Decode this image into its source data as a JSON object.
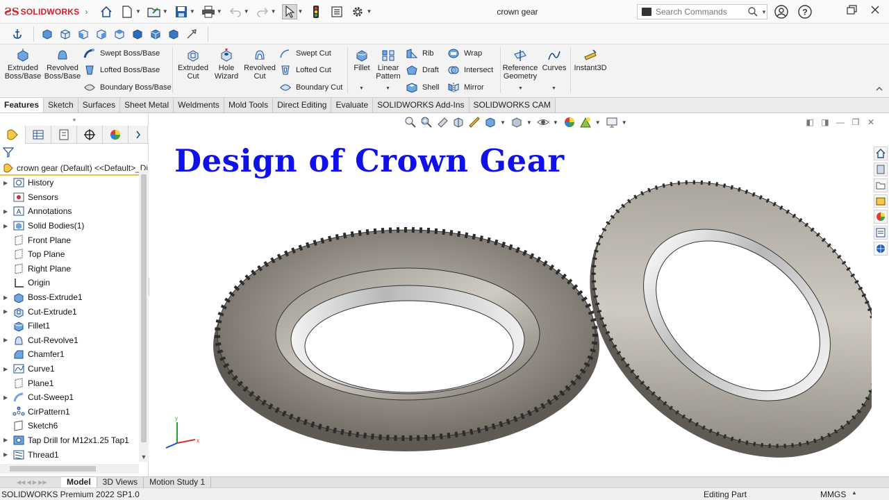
{
  "app": {
    "brand": "SOLIDWORKS",
    "doc_title": "crown gear"
  },
  "search": {
    "placeholder": "Search Commands"
  },
  "ribbon": {
    "extruded_boss": "Extruded Boss/Base",
    "revolved_boss": "Revolved Boss/Base",
    "swept_boss": "Swept Boss/Base",
    "lofted_boss": "Lofted Boss/Base",
    "boundary_boss": "Boundary Boss/Base",
    "extruded_cut": "Extruded Cut",
    "hole_wizard": "Hole Wizard",
    "revolved_cut": "Revolved Cut",
    "swept_cut": "Swept Cut",
    "lofted_cut": "Lofted Cut",
    "boundary_cut": "Boundary Cut",
    "fillet": "Fillet",
    "linear_pattern": "Linear Pattern",
    "rib": "Rib",
    "draft": "Draft",
    "shell": "Shell",
    "wrap": "Wrap",
    "intersect": "Intersect",
    "mirror": "Mirror",
    "reference_geometry": "Reference Geometry",
    "curves": "Curves",
    "instant3d": "Instant3D"
  },
  "tabs": [
    "Features",
    "Sketch",
    "Surfaces",
    "Sheet Metal",
    "Weldments",
    "Mold Tools",
    "Direct Editing",
    "Evaluate",
    "SOLIDWORKS Add-Ins",
    "SOLIDWORKS CAM"
  ],
  "tree": {
    "root": "crown gear (Default) <<Default>_Di",
    "items": [
      {
        "label": "History",
        "expandable": true,
        "icon": "history-icon"
      },
      {
        "label": "Sensors",
        "expandable": false,
        "icon": "sensor-icon"
      },
      {
        "label": "Annotations",
        "expandable": true,
        "icon": "annotation-icon"
      },
      {
        "label": "Solid Bodies(1)",
        "expandable": true,
        "icon": "solid-bodies-icon"
      },
      {
        "label": "Front Plane",
        "expandable": false,
        "icon": "plane-icon"
      },
      {
        "label": "Top Plane",
        "expandable": false,
        "icon": "plane-icon"
      },
      {
        "label": "Right Plane",
        "expandable": false,
        "icon": "plane-icon"
      },
      {
        "label": "Origin",
        "expandable": false,
        "icon": "origin-icon"
      },
      {
        "label": "Boss-Extrude1",
        "expandable": true,
        "icon": "extrude-icon"
      },
      {
        "label": "Cut-Extrude1",
        "expandable": true,
        "icon": "cut-extrude-icon"
      },
      {
        "label": "Fillet1",
        "expandable": false,
        "icon": "fillet-icon"
      },
      {
        "label": "Cut-Revolve1",
        "expandable": true,
        "icon": "cut-revolve-icon"
      },
      {
        "label": "Chamfer1",
        "expandable": false,
        "icon": "chamfer-icon"
      },
      {
        "label": "Curve1",
        "expandable": true,
        "icon": "curve-icon"
      },
      {
        "label": "Plane1",
        "expandable": false,
        "icon": "plane-icon"
      },
      {
        "label": "Cut-Sweep1",
        "expandable": true,
        "icon": "cut-sweep-icon"
      },
      {
        "label": "CirPattern1",
        "expandable": false,
        "icon": "circular-pattern-icon"
      },
      {
        "label": "Sketch6",
        "expandable": false,
        "icon": "sketch-icon"
      },
      {
        "label": "Tap Drill for M12x1.25 Tap1",
        "expandable": true,
        "icon": "hole-icon"
      },
      {
        "label": "Thread1",
        "expandable": true,
        "icon": "thread-icon"
      }
    ]
  },
  "viewport": {
    "heading": "Design of Crown Gear",
    "accent_color": "#1010e8"
  },
  "bottom_tabs": [
    "Model",
    "3D Views",
    "Motion Study 1"
  ],
  "status": {
    "product": "SOLIDWORKS Premium 2022 SP1.0",
    "mode": "Editing Part",
    "units": "MMGS"
  }
}
